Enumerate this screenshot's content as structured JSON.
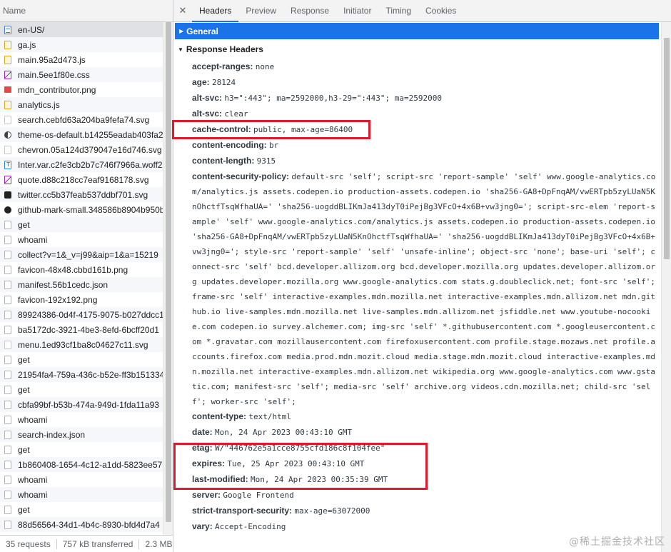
{
  "left_panel": {
    "column_header": "Name",
    "requests": [
      {
        "name": "en-US/",
        "icon": "document-icon",
        "kind": "doc",
        "selected": true
      },
      {
        "name": "ga.js",
        "icon": "script-icon",
        "kind": "js"
      },
      {
        "name": "main.95a2d473.js",
        "icon": "script-icon",
        "kind": "js"
      },
      {
        "name": "main.5ee1f80e.css",
        "icon": "stylesheet-icon",
        "kind": "css"
      },
      {
        "name": "mdn_contributor.png",
        "icon": "image-icon",
        "kind": "img"
      },
      {
        "name": "analytics.js",
        "icon": "script-icon",
        "kind": "js"
      },
      {
        "name": "search.cebfd63a204ba9fefa74.svg",
        "icon": "svg-icon",
        "kind": "svg"
      },
      {
        "name": "theme-os-default.b14255eadab403fa2",
        "icon": "theme-icon",
        "kind": "theme"
      },
      {
        "name": "chevron.05a124d379047e16d746.svg",
        "icon": "svg-icon",
        "kind": "svg"
      },
      {
        "name": "Inter.var.c2fe3cb2b7c746f7966a.woff2",
        "icon": "font-icon",
        "kind": "font"
      },
      {
        "name": "quote.d88c218cc7eaf9168178.svg",
        "icon": "svg-icon",
        "kind": "quote"
      },
      {
        "name": "twitter.cc5b37feab537ddbf701.svg",
        "icon": "twitter-icon",
        "kind": "twitter"
      },
      {
        "name": "github-mark-small.348586b8904b950b",
        "icon": "github-icon",
        "kind": "github"
      },
      {
        "name": "get",
        "icon": "request-icon",
        "kind": "plain"
      },
      {
        "name": "whoami",
        "icon": "request-icon",
        "kind": "plain"
      },
      {
        "name": "collect?v=1&_v=j99&aip=1&a=15219",
        "icon": "request-icon",
        "kind": "plain"
      },
      {
        "name": "favicon-48x48.cbbd161b.png",
        "icon": "request-icon",
        "kind": "plain"
      },
      {
        "name": "manifest.56b1cedc.json",
        "icon": "request-icon",
        "kind": "plain"
      },
      {
        "name": "favicon-192x192.png",
        "icon": "request-icon",
        "kind": "plain"
      },
      {
        "name": "89924386-0d4f-4175-9075-b027ddcc1",
        "icon": "request-icon",
        "kind": "plain"
      },
      {
        "name": "ba5172dc-3921-4be3-8efd-6bcff20d1",
        "icon": "request-icon",
        "kind": "plain"
      },
      {
        "name": "menu.1ed93cf1ba8c04627c11.svg",
        "icon": "svg-icon",
        "kind": "svg"
      },
      {
        "name": "get",
        "icon": "request-icon",
        "kind": "plain"
      },
      {
        "name": "21954fa4-759a-436c-b52e-ff3b151334",
        "icon": "request-icon",
        "kind": "plain"
      },
      {
        "name": "get",
        "icon": "request-icon",
        "kind": "plain"
      },
      {
        "name": "cbfa99bf-b53b-474a-949d-1fda11a93",
        "icon": "request-icon",
        "kind": "plain"
      },
      {
        "name": "whoami",
        "icon": "request-icon",
        "kind": "plain"
      },
      {
        "name": "search-index.json",
        "icon": "request-icon",
        "kind": "plain"
      },
      {
        "name": "get",
        "icon": "request-icon",
        "kind": "plain"
      },
      {
        "name": "1b860408-1654-4c12-a1dd-5823ee57",
        "icon": "request-icon",
        "kind": "plain"
      },
      {
        "name": "whoami",
        "icon": "request-icon",
        "kind": "plain"
      },
      {
        "name": "whoami",
        "icon": "request-icon",
        "kind": "plain"
      },
      {
        "name": "get",
        "icon": "request-icon",
        "kind": "plain"
      },
      {
        "name": "88d56564-34d1-4b4c-8930-bfd4d7a4",
        "icon": "request-icon",
        "kind": "plain"
      }
    ],
    "status": {
      "requests": "35 requests",
      "transferred": "757 kB transferred",
      "resources": "2.3 MB"
    }
  },
  "tabs": {
    "close_glyph": "✕",
    "items": [
      "Headers",
      "Preview",
      "Response",
      "Initiator",
      "Timing",
      "Cookies"
    ],
    "active": "Headers"
  },
  "sections": {
    "general": "General",
    "response_headers": "Response Headers"
  },
  "headers": [
    {
      "name": "accept-ranges:",
      "value": "none"
    },
    {
      "name": "age:",
      "value": "28124"
    },
    {
      "name": "alt-svc:",
      "value": "h3=\":443\"; ma=2592000,h3-29=\":443\"; ma=2592000"
    },
    {
      "name": "alt-svc:",
      "value": "clear"
    },
    {
      "name": "cache-control:",
      "value": "public, max-age=86400",
      "highlighted": true
    },
    {
      "name": "content-encoding:",
      "value": "br"
    },
    {
      "name": "content-length:",
      "value": "9315"
    },
    {
      "name": "content-security-policy:",
      "value": "default-src 'self'; script-src 'report-sample' 'self' www.google-analytics.com/analytics.js assets.codepen.io production-assets.codepen.io 'sha256-GA8+DpFnqAM/vwERTpb5zyLUaN5KnOhctfTsqWfhaUA=' 'sha256-uogddBLIKmJa413dyT0iPejBg3VFcO+4x6B+vw3jng0='; script-src-elem 'report-sample' 'self' www.google-analytics.com/analytics.js assets.codepen.io production-assets.codepen.io 'sha256-GA8+DpFnqAM/vwERTpb5zyLUaN5KnOhctfTsqWfhaUA=' 'sha256-uogddBLIKmJa413dyT0iPejBg3VFcO+4x6B+vw3jng0='; style-src 'report-sample' 'self' 'unsafe-inline'; object-src 'none'; base-uri 'self'; connect-src 'self' bcd.developer.allizom.org bcd.developer.mozilla.org updates.developer.allizom.org updates.developer.mozilla.org www.google-analytics.com stats.g.doubleclick.net; font-src 'self'; frame-src 'self' interactive-examples.mdn.mozilla.net interactive-examples.mdn.allizom.net mdn.github.io live-samples.mdn.mozilla.net live-samples.mdn.allizom.net jsfiddle.net www.youtube-nocookie.com codepen.io survey.alchemer.com; img-src 'self' *.githubusercontent.com *.googleusercontent.com *.gravatar.com mozillausercontent.com firefoxusercontent.com profile.stage.mozaws.net profile.accounts.firefox.com media.prod.mdn.mozit.cloud media.stage.mdn.mozit.cloud interactive-examples.mdn.mozilla.net interactive-examples.mdn.allizom.net wikipedia.org www.google-analytics.com www.gstatic.com; manifest-src 'self'; media-src 'self' archive.org videos.cdn.mozilla.net; child-src 'self'; worker-src 'self';",
      "long": true
    },
    {
      "name": "content-type:",
      "value": "text/html"
    },
    {
      "name": "date:",
      "value": "Mon, 24 Apr 2023 00:43:10 GMT"
    },
    {
      "name": "etag:",
      "value": "W/\"446762e5a1cce8755cfd186c8f104fee\"",
      "highlighted": true
    },
    {
      "name": "expires:",
      "value": "Tue, 25 Apr 2023 00:43:10 GMT",
      "highlighted": true
    },
    {
      "name": "last-modified:",
      "value": "Mon, 24 Apr 2023 00:35:39 GMT",
      "highlighted": true
    },
    {
      "name": "server:",
      "value": "Google Frontend"
    },
    {
      "name": "strict-transport-security:",
      "value": "max-age=63072000"
    },
    {
      "name": "vary:",
      "value": "Accept-Encoding"
    }
  ],
  "watermark": "@稀土掘金技术社区",
  "colors": {
    "accent": "#1a73e8",
    "highlight_box": "#e0192c"
  }
}
